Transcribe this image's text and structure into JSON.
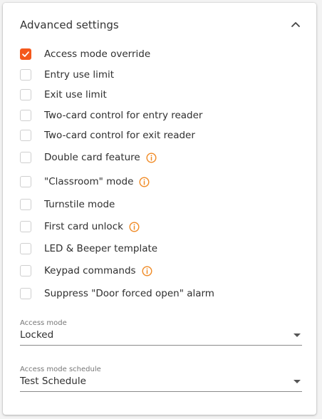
{
  "section": {
    "title": "Advanced settings",
    "collapse_icon": "chevron-up-icon"
  },
  "options": [
    {
      "label": "Access mode override",
      "checked": true,
      "info": false
    },
    {
      "label": "Entry use limit",
      "checked": false,
      "info": false
    },
    {
      "label": "Exit use limit",
      "checked": false,
      "info": false
    },
    {
      "label": "Two-card control for entry reader",
      "checked": false,
      "info": false
    },
    {
      "label": "Two-card control for exit reader",
      "checked": false,
      "info": false
    },
    {
      "label": "Double card feature",
      "checked": false,
      "info": true
    },
    {
      "label": "\"Classroom\" mode",
      "checked": false,
      "info": true
    },
    {
      "label": "Turnstile mode",
      "checked": false,
      "info": false
    },
    {
      "label": "First card unlock",
      "checked": false,
      "info": true
    },
    {
      "label": "LED & Beeper template",
      "checked": false,
      "info": false
    },
    {
      "label": "Keypad commands",
      "checked": false,
      "info": true
    },
    {
      "label": "Suppress \"Door forced open\" alarm",
      "checked": false,
      "info": false
    }
  ],
  "access_mode": {
    "label": "Access mode",
    "value": "Locked"
  },
  "access_mode_schedule": {
    "label": "Access mode schedule",
    "value": "Test Schedule"
  },
  "colors": {
    "accent": "#f4581c",
    "info_icon": "#f08a24"
  }
}
